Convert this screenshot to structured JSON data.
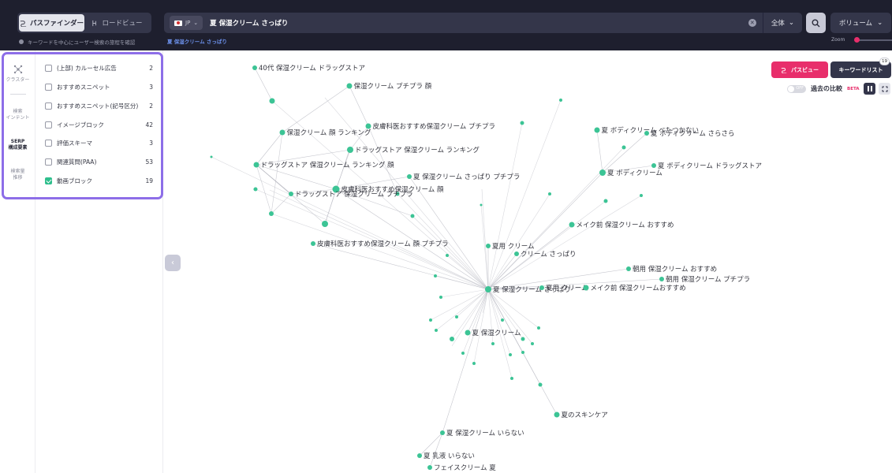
{
  "header": {
    "modes": [
      {
        "label": "パスファインダー",
        "active": true
      },
      {
        "label": "ロードビュー",
        "active": false
      }
    ],
    "hint": "キーワードを中心にユーザー検索の旅程を確認",
    "country": "JP",
    "query": "夏 保湿クリーム さっぱり",
    "sub_query": "夏 保湿クリーム さっぱり",
    "scope": "全体",
    "sort": "ボリューム",
    "zoom_label": "Zoom"
  },
  "rail": {
    "items": [
      {
        "label": "クラスター",
        "active": false
      },
      {
        "label": "検索\nインテント",
        "active": false
      },
      {
        "label": "SERP\n構成要素",
        "active": true
      },
      {
        "label": "検索量\n推移",
        "active": false
      }
    ]
  },
  "serp": {
    "items": [
      {
        "label": "(上部) カルーセル広告",
        "count": "2",
        "checked": false
      },
      {
        "label": "おすすめスニペット",
        "count": "3",
        "checked": false
      },
      {
        "label": "おすすめスニペット(記号区分)",
        "count": "2",
        "checked": false
      },
      {
        "label": "イメージブロック",
        "count": "42",
        "checked": false
      },
      {
        "label": "評価スキーマ",
        "count": "3",
        "checked": false
      },
      {
        "label": "関連質問(PAA)",
        "count": "53",
        "checked": false
      },
      {
        "label": "動画ブロック",
        "count": "19",
        "checked": true
      }
    ]
  },
  "controls": {
    "pathview_label": "パスビュー",
    "kwlist_label": "キーワードリスト",
    "kwlist_badge": "19",
    "compare_label": "過去の比較",
    "beta_label": "BETA"
  },
  "graph": {
    "accent_color": "#3cc495",
    "nodes": [
      {
        "label": "40代 保湿クリーム ドラッグストア"
      },
      {
        "label": "保湿クリーム プチプラ 顔"
      },
      {
        "label": "皮膚科医おすすめ保湿クリーム プチプラ"
      },
      {
        "label": "保湿クリーム 顔 ランキング"
      },
      {
        "label": "ドラッグストア 保湿クリーム ランキング"
      },
      {
        "label": "ドラッグストア 保湿クリーム ランキング 顔"
      },
      {
        "label": "夏 保湿クリーム さっぱり プチプラ"
      },
      {
        "label": "皮膚科医おすすめ保湿クリーム 顔"
      },
      {
        "label": "ドラッグストア 保湿クリーム プチプラ"
      },
      {
        "label": "夏 ボディクリーム べたつかない"
      },
      {
        "label": "夏 ボディクリーム さらさら"
      },
      {
        "label": "夏 ボディクリーム ドラッグストア"
      },
      {
        "label": "夏 ボディクリーム"
      },
      {
        "label": "メイク前 保湿クリーム おすすめ"
      },
      {
        "label": "皮膚科医おすすめ保湿クリーム 顔 プチプラ"
      },
      {
        "label": "夏用 クリーム"
      },
      {
        "label": "クリーム さっぱり"
      },
      {
        "label": "朝用 保湿クリーム おすすめ"
      },
      {
        "label": "朝用 保湿クリーム プチプラ"
      },
      {
        "label": "夏 保湿クリーム さっぱり"
      },
      {
        "label": "夏用 クリーム"
      },
      {
        "label": "メイク前 保湿クリームおすすめ"
      },
      {
        "label": "夏 保湿クリーム"
      },
      {
        "label": "夏のスキンケア"
      },
      {
        "label": "夏 保湿クリーム いらない"
      },
      {
        "label": "夏 乳液 いらない"
      },
      {
        "label": "フェイスクリーム 夏"
      }
    ]
  }
}
